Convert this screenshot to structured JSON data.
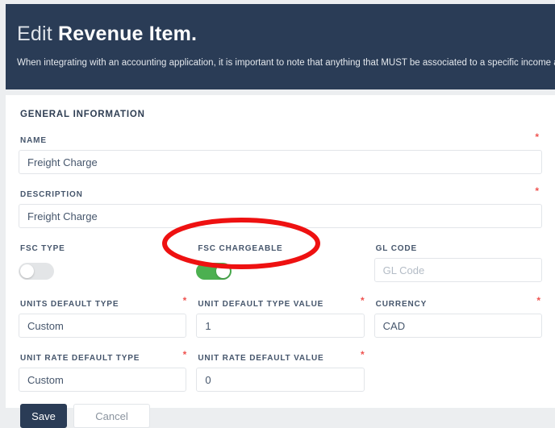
{
  "banner": {
    "title_light": "Edit",
    "title_strong": "Revenue Item.",
    "subtitle": "When integrating with an accounting application, it is important to note that anything that MUST be associated to a specific income account"
  },
  "card": {
    "section_title": "GENERAL INFORMATION",
    "fields": {
      "name": {
        "label": "NAME",
        "value": "Freight Charge",
        "required": "*"
      },
      "description": {
        "label": "DESCRIPTION",
        "value": "Freight Charge",
        "required": "*"
      },
      "fsc_type": {
        "label": "FSC TYPE",
        "state": "off"
      },
      "fsc_chargeable": {
        "label": "FSC CHARGEABLE",
        "state": "on"
      },
      "gl_code": {
        "label": "GL CODE",
        "value": "",
        "placeholder": "GL Code"
      },
      "units_default_type": {
        "label": "UNITS DEFAULT TYPE",
        "value": "Custom",
        "required": "*"
      },
      "unit_default_type_value": {
        "label": "UNIT DEFAULT TYPE VALUE",
        "value": "1",
        "required": "*"
      },
      "currency": {
        "label": "CURRENCY",
        "value": "CAD",
        "required": "*"
      },
      "unit_rate_default_type": {
        "label": "UNIT RATE DEFAULT TYPE",
        "value": "Custom",
        "required": "*"
      },
      "unit_rate_default_value": {
        "label": "UNIT RATE DEFAULT VALUE",
        "value": "0",
        "required": "*"
      }
    },
    "buttons": {
      "save": "Save",
      "cancel": "Cancel"
    }
  },
  "annotation": {
    "shape": "ellipse",
    "color": "#ee1111",
    "target": "fsc-chargeable-toggle"
  },
  "colors": {
    "banner_background": "#2a3c56",
    "page_background": "#eceef0",
    "card_background": "#ffffff",
    "toggle_on": "#4cb050",
    "toggle_off": "#e3e5e7",
    "required_marker": "#ef5350",
    "label_text": "#46566c",
    "save_button": "#2a3c56"
  }
}
